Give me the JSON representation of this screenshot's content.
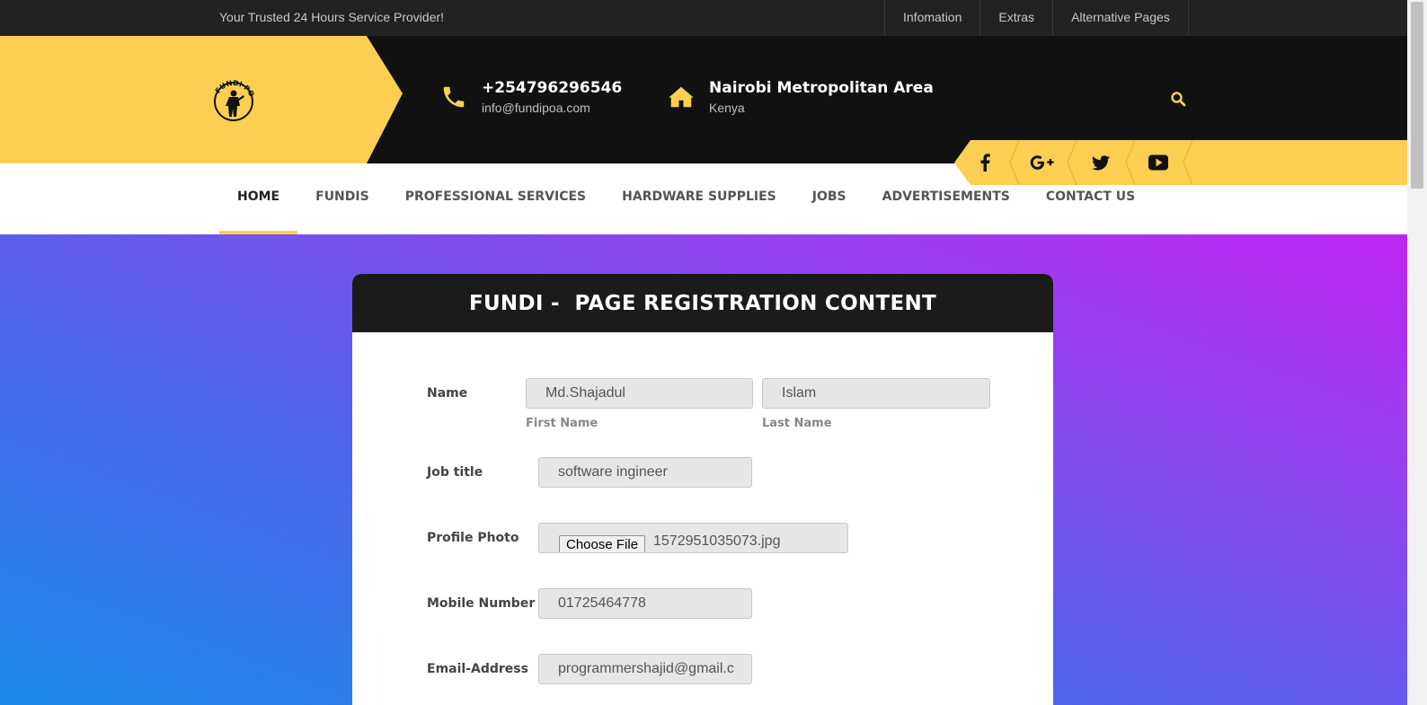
{
  "topbar": {
    "tagline": "Your Trusted 24 Hours Service Provider!",
    "links": [
      "Infomation",
      "Extras",
      "Alternative Pages"
    ]
  },
  "header": {
    "logo_text": "FUNDI POA",
    "phone": "+254796296546",
    "email": "info@fundipoa.com",
    "location": "Nairobi Metropolitan Area",
    "country": "Kenya",
    "icons": [
      "phone-icon",
      "home-icon",
      "search-icon"
    ]
  },
  "social": [
    "facebook-icon",
    "google-plus-icon",
    "twitter-icon",
    "youtube-icon"
  ],
  "nav": {
    "items": [
      "HOME",
      "FUNDIS",
      "PROFESSIONAL SERVICES",
      "HARDWARE SUPPLIES",
      "JOBS",
      "ADVERTISEMENTS",
      "CONTACT US"
    ],
    "active": "HOME"
  },
  "form": {
    "title": "FUNDI -  PAGE REGISTRATION CONTENT",
    "name_label": "Name",
    "first_name": "Md.Shajadul",
    "last_name": "Islam",
    "first_name_caption": "First Name",
    "last_name_caption": "Last Name",
    "job_label": "Job title",
    "job_value": "software ingineer",
    "photo_label": "Profile Photo",
    "choose_file": "Choose File",
    "file_name": "1572951035073.jpg",
    "mobile_label": "Mobile Number",
    "mobile_value": "01725464778",
    "email_label": "Email-Address",
    "email_value": "programmershajid@gmail.c"
  },
  "colors": {
    "accent": "#fccf52",
    "dark": "#111111",
    "gradient_start": "#1a8ae6",
    "gradient_end": "#c026f3"
  }
}
